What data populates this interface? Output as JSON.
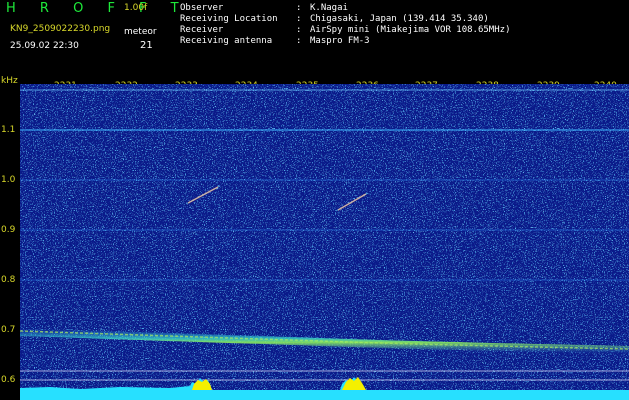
{
  "header": {
    "title": "H R O F F T",
    "version": "1.00f",
    "filename": "KN9_2509022230.png",
    "meteor_label": "meteor",
    "meteor_count": "21",
    "datetime": "25.09.02 22:30"
  },
  "info": [
    {
      "key": "Observer",
      "value": "K.Nagai"
    },
    {
      "key": "Receiving Location",
      "value": "Chigasaki, Japan (139.414 35.340)"
    },
    {
      "key": "Receiver",
      "value": "AirSpy mini (Miakejima VOR 108.65MHz)"
    },
    {
      "key": "Receiving antenna",
      "value": "Maspro FM-3"
    }
  ],
  "axis": {
    "y_unit": "kHz",
    "time_labels": [
      "2231",
      "2232",
      "2233",
      "2234",
      "2235",
      "2236",
      "2237",
      "2238",
      "2239",
      "2240"
    ],
    "freq_labels": [
      "1.1",
      "1.0",
      "0.9",
      "0.8",
      "0.7",
      "0.6"
    ]
  },
  "colors": {
    "background": "#0a1a8a",
    "header_text": "#d8d82a",
    "title": "#1eea3a",
    "signal": "#2fe0ff"
  }
}
